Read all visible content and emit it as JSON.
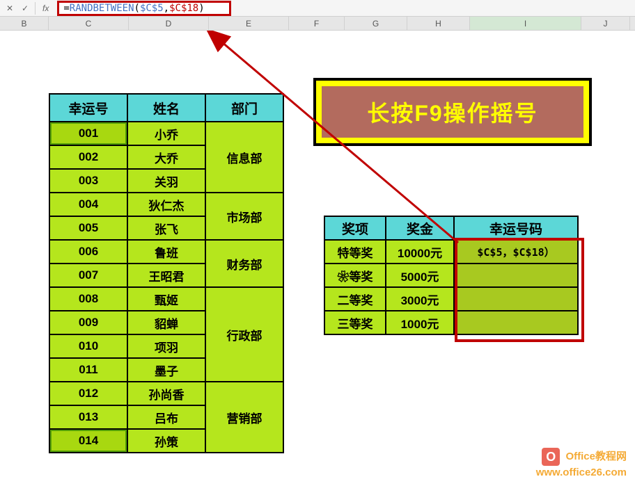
{
  "formula_bar": {
    "cancel": "✕",
    "confirm": "✓",
    "fx": "fx",
    "formula_prefix": "=",
    "fn_name": "RANDBETWEEN",
    "open": "(",
    "ref1": "$C$5",
    "comma": ",",
    "ref2": "$C$18",
    "close": ")"
  },
  "columns": {
    "B": "B",
    "C": "C",
    "D": "D",
    "E": "E",
    "F": "F",
    "G": "G",
    "H": "H",
    "I": "I",
    "J": "J"
  },
  "left_headers": [
    "幸运号",
    "姓名",
    "部门"
  ],
  "left_rows": [
    {
      "num": "001",
      "name": "小乔"
    },
    {
      "num": "002",
      "name": "大乔"
    },
    {
      "num": "003",
      "name": "关羽"
    },
    {
      "num": "004",
      "name": "狄仁杰"
    },
    {
      "num": "005",
      "name": "张飞"
    },
    {
      "num": "006",
      "name": "鲁班"
    },
    {
      "num": "007",
      "name": "王昭君"
    },
    {
      "num": "008",
      "name": "甄姬"
    },
    {
      "num": "009",
      "name": "貂蝉"
    },
    {
      "num": "010",
      "name": "项羽"
    },
    {
      "num": "011",
      "name": "墨子"
    },
    {
      "num": "012",
      "name": "孙尚香"
    },
    {
      "num": "013",
      "name": "吕布"
    },
    {
      "num": "014",
      "name": "孙策"
    }
  ],
  "left_depts": [
    "信息部",
    "市场部",
    "财务部",
    "行政部",
    "营销部"
  ],
  "banner": "长按F9操作摇号",
  "right_headers": [
    "奖项",
    "奖金",
    "幸运号码"
  ],
  "right_rows": [
    {
      "award": "特等奖",
      "prize": "10000元",
      "num": "$C$5，$C$18）"
    },
    {
      "award": "❀等奖",
      "prize": "5000元",
      "num": ""
    },
    {
      "award": "二等奖",
      "prize": "3000元",
      "num": ""
    },
    {
      "award": "三等奖",
      "prize": "1000元",
      "num": ""
    }
  ],
  "watermark": {
    "badge": "O",
    "line1": "Office教程网",
    "line2": "www.office26.com"
  }
}
